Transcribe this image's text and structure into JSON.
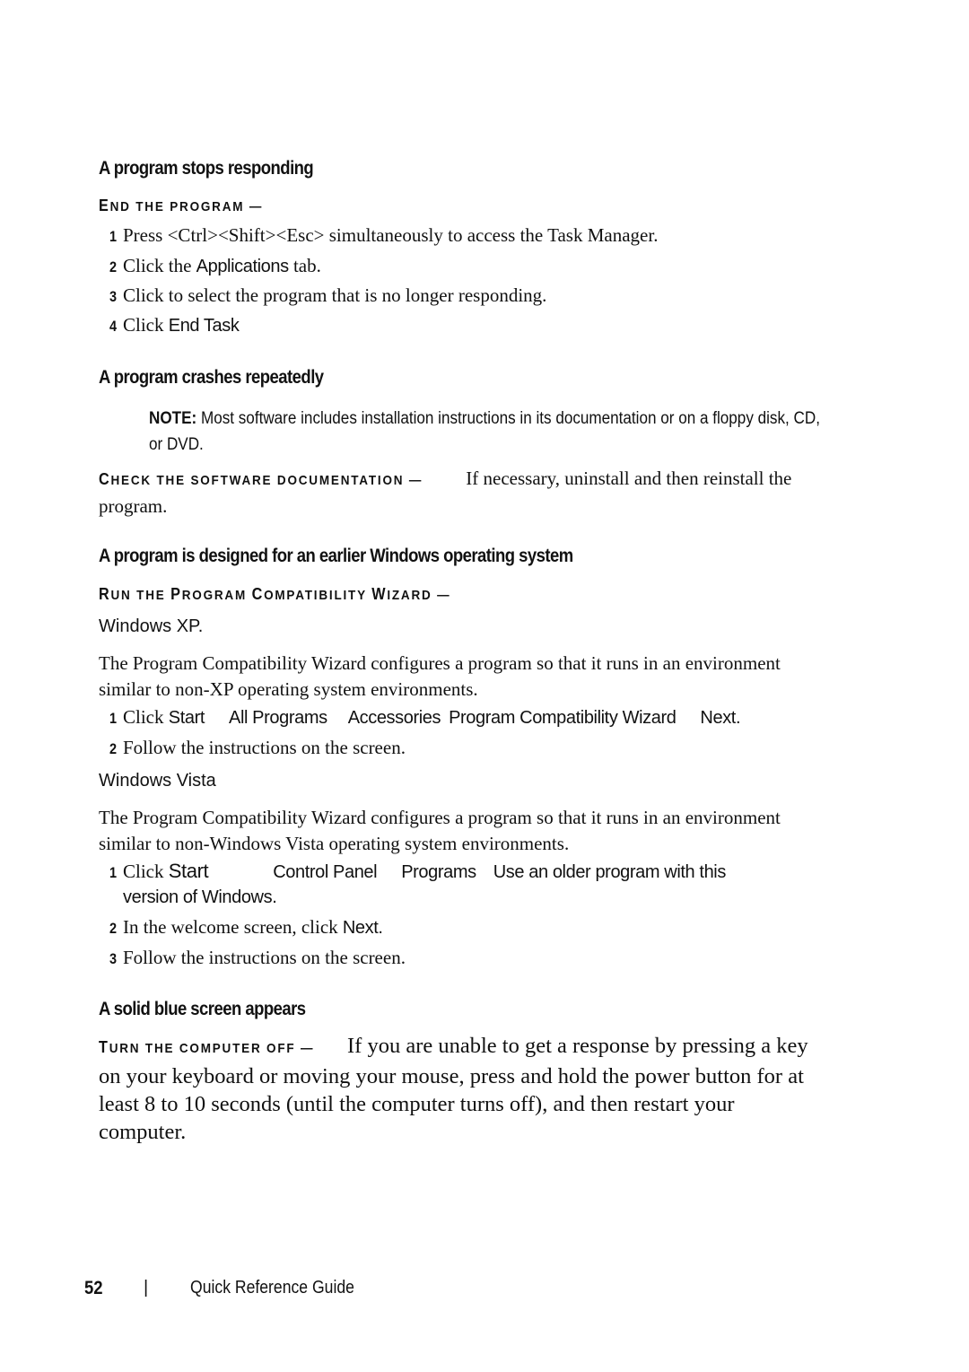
{
  "sections": {
    "stops": {
      "heading": "A program stops responding",
      "runin_first": "E",
      "runin_rest": "nd the program —",
      "steps": [
        {
          "num": "1",
          "pre": "Press <Ctrl><Shift><Esc> simultaneously to access the Task Manager.",
          "ui": "",
          "post": ""
        },
        {
          "num": "2",
          "pre": "Click the ",
          "ui": "Applications",
          "post": " tab."
        },
        {
          "num": "3",
          "pre": "Click to select the program that is no longer responding.",
          "ui": "",
          "post": ""
        },
        {
          "num": "4",
          "pre": "Click ",
          "ui": "End Task",
          "post": ""
        }
      ]
    },
    "crashes": {
      "heading": "A program crashes repeatedly",
      "note_label": "NOTE:",
      "note_text": " Most software includes installation instructions in its documentation or on a floppy disk, CD, or DVD.",
      "runin_first": "C",
      "runin_rest": "heck the software documentation —",
      "text": "If necessary, uninstall and then reinstall the program."
    },
    "earlier": {
      "heading": "A program is designed for an earlier Windows operating system",
      "runin_parts": [
        {
          "cap": "R",
          "rest": "un the "
        },
        {
          "cap": "P",
          "rest": "rogram "
        },
        {
          "cap": "C",
          "rest": "ompatibility "
        },
        {
          "cap": "W",
          "rest": "izard —"
        }
      ],
      "xp": {
        "title": "Windows XP.",
        "text": "The Program Compatibility Wizard configures a program so that it runs in an environment similar to non-XP operating system environments.",
        "step1": {
          "num": "1",
          "pre": "Click ",
          "items": [
            "Start",
            "All Programs",
            "Accessories",
            "Program Compatibility Wizard",
            "Next."
          ]
        },
        "step2": {
          "num": "2",
          "text": "Follow the instructions on the screen."
        }
      },
      "vista": {
        "title": "Windows Vista",
        "text": "The Program Compatibility Wizard configures a program so that it runs in an environment similar to non-Windows Vista operating system environments.",
        "step1": {
          "num": "1",
          "pre": "Click ",
          "items": [
            "Start",
            "Control Panel",
            "Programs",
            "Use an older program with this"
          ],
          "line2": "version of Windows."
        },
        "step2": {
          "num": "2",
          "pre": "In the welcome screen, click ",
          "ui": "Next."
        },
        "step3": {
          "num": "3",
          "text": "Follow the instructions on the screen."
        }
      }
    },
    "blue": {
      "heading": "A solid blue screen appears",
      "runin_first": "T",
      "runin_rest": "urn the computer off —",
      "text": "If you are unable to get a response by pressing a key on your keyboard or moving your mouse, press and hold the power button for at least 8 to 10 seconds (until the computer turns off), and then restart your computer."
    }
  },
  "footer": {
    "page_number": "52",
    "separator": "|",
    "title": "Quick Reference Guide"
  }
}
